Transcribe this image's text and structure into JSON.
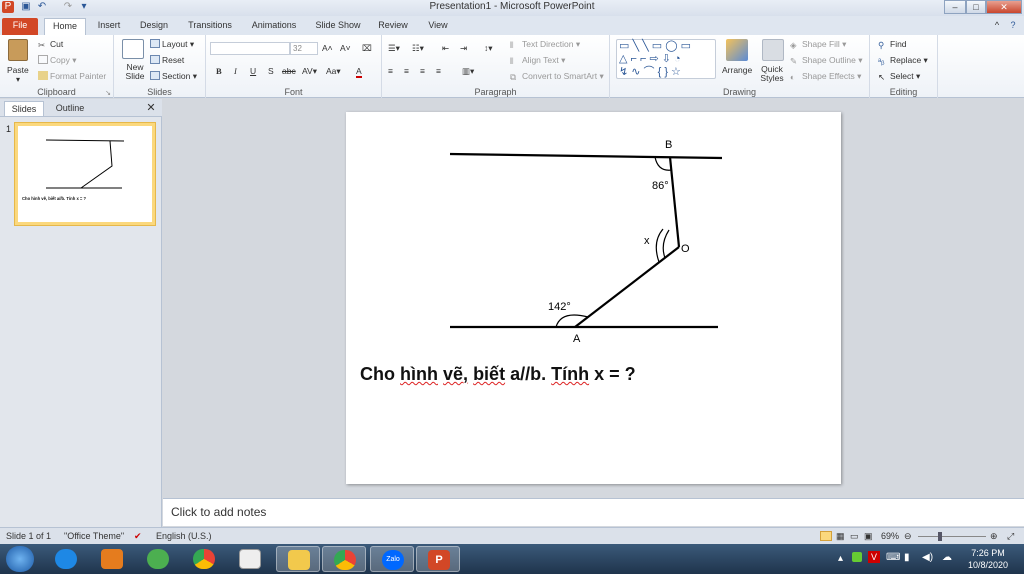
{
  "window": {
    "title": "Presentation1 - Microsoft PowerPoint"
  },
  "tabs": [
    "File",
    "Home",
    "Insert",
    "Design",
    "Transitions",
    "Animations",
    "Slide Show",
    "Review",
    "View"
  ],
  "ribbon": {
    "clipboard": {
      "label": "Clipboard",
      "paste": "Paste",
      "cut": "Cut",
      "copy": "Copy",
      "format_painter": "Format Painter"
    },
    "slides": {
      "label": "Slides",
      "new_slide": "New Slide",
      "layout": "Layout",
      "reset": "Reset",
      "section": "Section"
    },
    "font": {
      "label": "Font",
      "font_name": "",
      "font_size": "32"
    },
    "paragraph": {
      "label": "Paragraph",
      "text_direction": "Text Direction",
      "align_text": "Align Text",
      "convert_smartart": "Convert to SmartArt"
    },
    "drawing": {
      "label": "Drawing",
      "arrange": "Arrange",
      "quick_styles": "Quick Styles",
      "shape_fill": "Shape Fill",
      "shape_outline": "Shape Outline",
      "shape_effects": "Shape Effects"
    },
    "editing": {
      "label": "Editing",
      "find": "Find",
      "replace": "Replace",
      "select": "Select"
    }
  },
  "left_pane": {
    "tabs": [
      "Slides",
      "Outline"
    ],
    "slide_number": "1"
  },
  "slide": {
    "label_b": "B",
    "label_a": "A",
    "label_o": "O",
    "label_x": "x",
    "angle_top": "86°",
    "angle_bottom": "142°",
    "question_prefix": "Cho ",
    "question_w1": "hình",
    "question_sp1": " ",
    "question_w2": "vẽ,",
    "question_sp2": " ",
    "question_w3": "biết",
    "question_mid": " a//b. ",
    "question_w4": "Tính",
    "question_suffix": " x = ?"
  },
  "thumb_text": "Cho hình vẽ, biết a//b. Tính x = ?",
  "notes": {
    "placeholder": "Click to add notes"
  },
  "status": {
    "slide_info": "Slide 1 of 1",
    "theme": "\"Office Theme\"",
    "language": "English (U.S.)",
    "zoom": "69%"
  },
  "taskbar": {
    "time": "7:26 PM",
    "date": "10/8/2020",
    "zalo": "Zalo"
  },
  "colors": {
    "file_tab": "#d24726",
    "accent": "#2b5797",
    "thumb_selected": "#fbd87d"
  }
}
